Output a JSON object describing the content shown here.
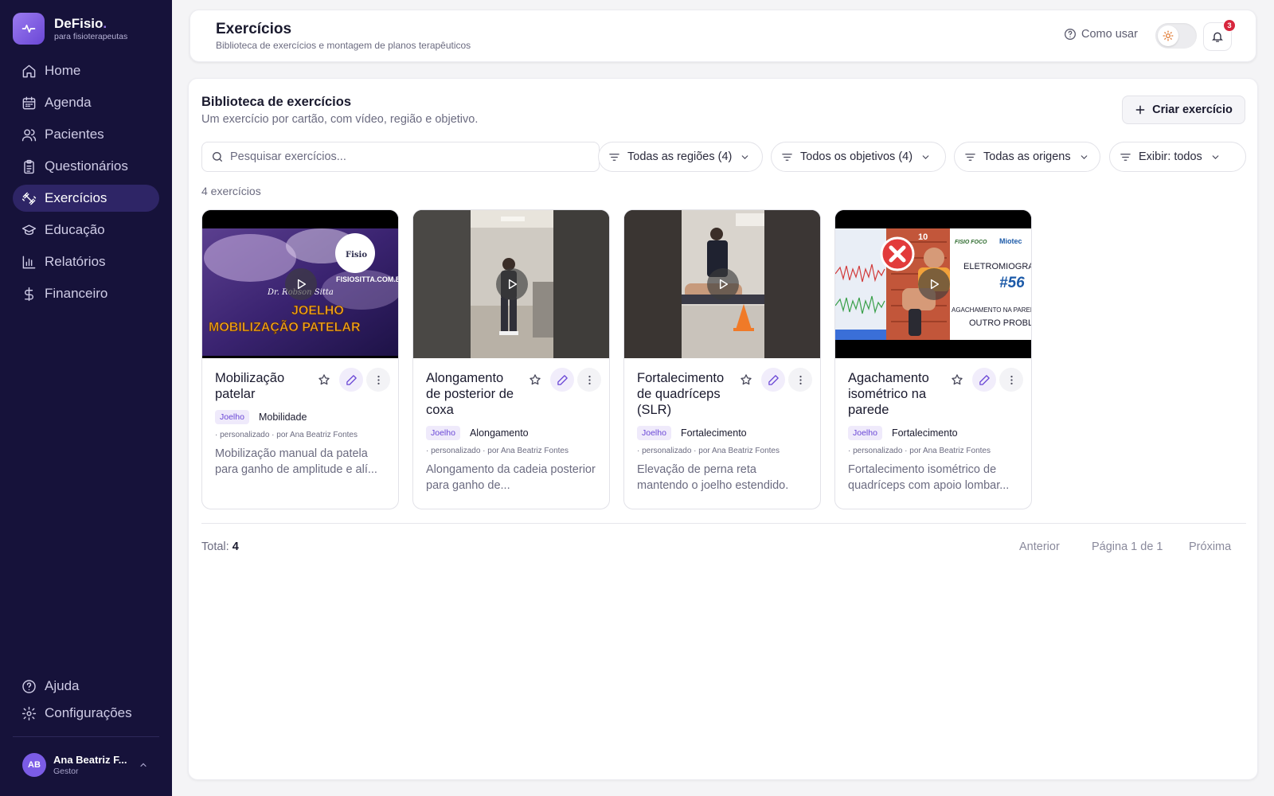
{
  "brand": {
    "name": "DeFisio",
    "dot": ".",
    "tagline": "para fisioterapeutas"
  },
  "sidebar": {
    "items": [
      {
        "label": "Home",
        "icon": "home-icon",
        "active": false
      },
      {
        "label": "Agenda",
        "icon": "calendar-icon",
        "active": false
      },
      {
        "label": "Pacientes",
        "icon": "users-icon",
        "active": false
      },
      {
        "label": "Questionários",
        "icon": "clipboard-icon",
        "active": false
      },
      {
        "label": "Exercícios",
        "icon": "dumbbell-icon",
        "active": true
      },
      {
        "label": "Educação",
        "icon": "graduation-cap-icon",
        "active": false
      },
      {
        "label": "Relatórios",
        "icon": "bar-chart-icon",
        "active": false
      },
      {
        "label": "Financeiro",
        "icon": "dollar-icon",
        "active": false
      }
    ],
    "bottom": [
      {
        "label": "Ajuda",
        "icon": "help-circle-icon"
      },
      {
        "label": "Configurações",
        "icon": "gear-icon"
      }
    ],
    "user": {
      "initials": "AB",
      "name": "Ana Beatriz F...",
      "role": "Gestor"
    }
  },
  "header": {
    "title": "Exercícios",
    "subtitle": "Biblioteca de exercícios e montagem de planos terapêuticos",
    "how_to": "Como usar",
    "notifications": "3"
  },
  "library": {
    "title": "Biblioteca de exercícios",
    "subtitle": "Um exercício por cartão, com vídeo, região e objetivo.",
    "create_label": "Criar exercício",
    "search_placeholder": "Pesquisar exercícios...",
    "filters": [
      "Todas as regiões (4)",
      "Todos os objetivos (4)",
      "Todas as origens",
      "Exibir: todos"
    ],
    "count_label": "4 exercícios"
  },
  "exercises": [
    {
      "title": "Mobilização patelar",
      "region": "Joelho",
      "objective": "Mobilidade",
      "meta": "· personalizado · por Ana Beatriz Fontes",
      "description": "Mobilização manual da patela para ganho de amplitude e alí...",
      "thumb": {
        "site": "FISIOSITTA.COM.BR",
        "line1": "JOELHO",
        "line2": "MOBILIZAÇÃO PATELAR",
        "logo": "Fisio",
        "signature": "Dr. Robson Sitta",
        "accent": "#f5a623"
      }
    },
    {
      "title": "Alongamento de posterior de coxa",
      "region": "Joelho",
      "objective": "Alongamento",
      "meta": "· personalizado · por Ana Beatriz Fontes",
      "description": "Alongamento da cadeia posterior para ganho de..."
    },
    {
      "title": "Fortalecimento de quadríceps (SLR)",
      "region": "Joelho",
      "objective": "Fortalecimento",
      "meta": "· personalizado · por Ana Beatriz Fontes",
      "description": "Elevação de perna reta mantendo o joelho estendido."
    },
    {
      "title": "Agachamento isométrico na parede",
      "region": "Joelho",
      "objective": "Fortalecimento",
      "meta": "· personalizado · por Ana Beatriz Fontes",
      "description": "Fortalecimento isométrico de quadríceps com apoio lombar...",
      "thumb": {
        "brand1": "Miotec",
        "brand2": "FISIO FOCO",
        "heading": "ELETROMIOGRAFIA",
        "number": "#56",
        "line1": "AGACHAMENTO NA PAREDE",
        "line2": "OUTRO PROBLEMA",
        "corner": "10"
      }
    }
  ],
  "footer": {
    "total_label": "Total:",
    "total_value": "4",
    "prev": "Anterior",
    "page": "Página 1 de 1",
    "next": "Próxima"
  },
  "colors": {
    "sidebar_bg": "#16123a",
    "active_bg": "#2e2566",
    "accent": "#6a47d6",
    "badge": "#d7263d"
  }
}
